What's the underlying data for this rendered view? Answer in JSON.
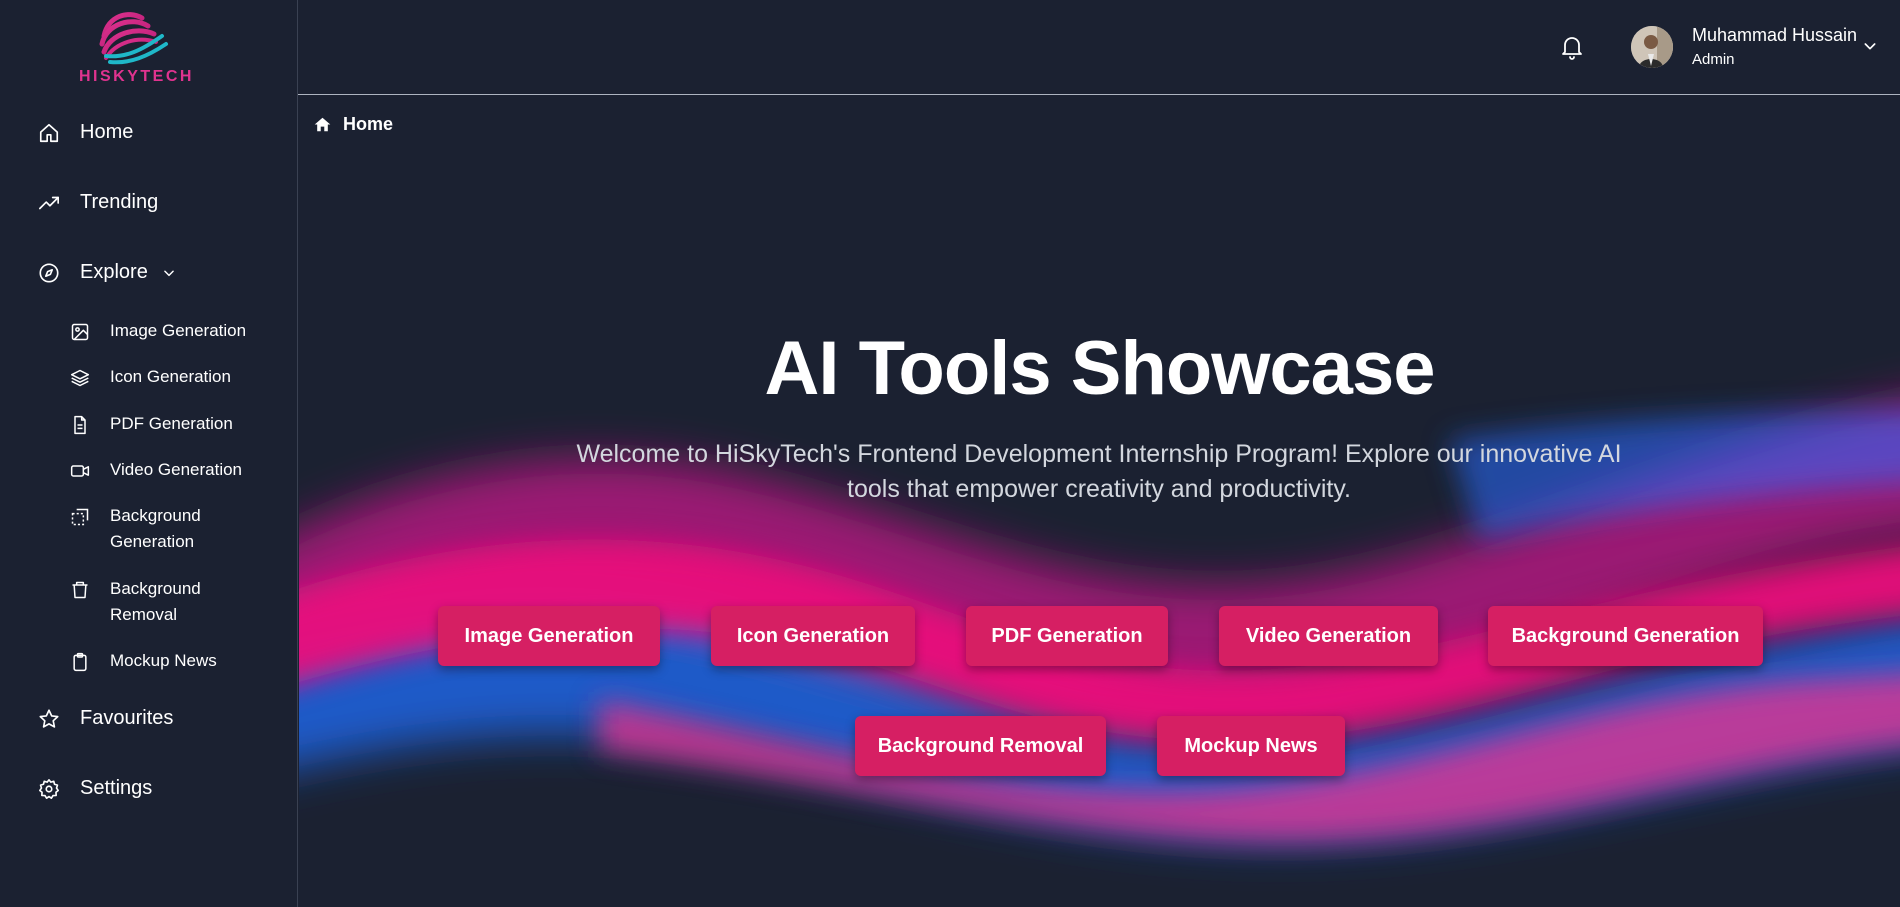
{
  "brand": {
    "name": "HISKYTECH"
  },
  "sidebar": {
    "nav": [
      {
        "label": "Home",
        "icon": "home-icon"
      },
      {
        "label": "Trending",
        "icon": "trending-up-icon"
      },
      {
        "label": "Explore",
        "icon": "compass-icon"
      },
      {
        "label": "Favourites",
        "icon": "star-icon"
      },
      {
        "label": "Settings",
        "icon": "gear-icon"
      }
    ],
    "sub_items": [
      {
        "label": "Image Generation",
        "icon": "image-icon"
      },
      {
        "label": "Icon Generation",
        "icon": "layers-icon"
      },
      {
        "label": "PDF Generation",
        "icon": "file-text-icon"
      },
      {
        "label": "Video Generation",
        "icon": "video-icon"
      },
      {
        "label": "Background Generation",
        "icon": "background-icon"
      },
      {
        "label": "Background Removal",
        "icon": "trash-icon"
      },
      {
        "label": "Mockup News",
        "icon": "clipboard-icon"
      }
    ]
  },
  "header": {
    "user": {
      "name": "Muhammad Hussain",
      "role": "Admin"
    }
  },
  "breadcrumb": {
    "label": "Home"
  },
  "hero": {
    "title": "AI Tools Showcase",
    "subtitle": "Welcome to HiSkyTech's Frontend Development Internship Program! Explore our innovative AI tools that empower creativity and productivity.",
    "buttons": [
      "Image Generation",
      "Icon Generation",
      "PDF Generation",
      "Video Generation",
      "Background Generation",
      "Background Removal",
      "Mockup News"
    ]
  },
  "colors": {
    "background": "#1b2131",
    "accent": "#d61f63",
    "brand_pink": "#e0338f",
    "brand_cyan": "#1fb8c9",
    "wave_blue": "#1e5fd8"
  }
}
